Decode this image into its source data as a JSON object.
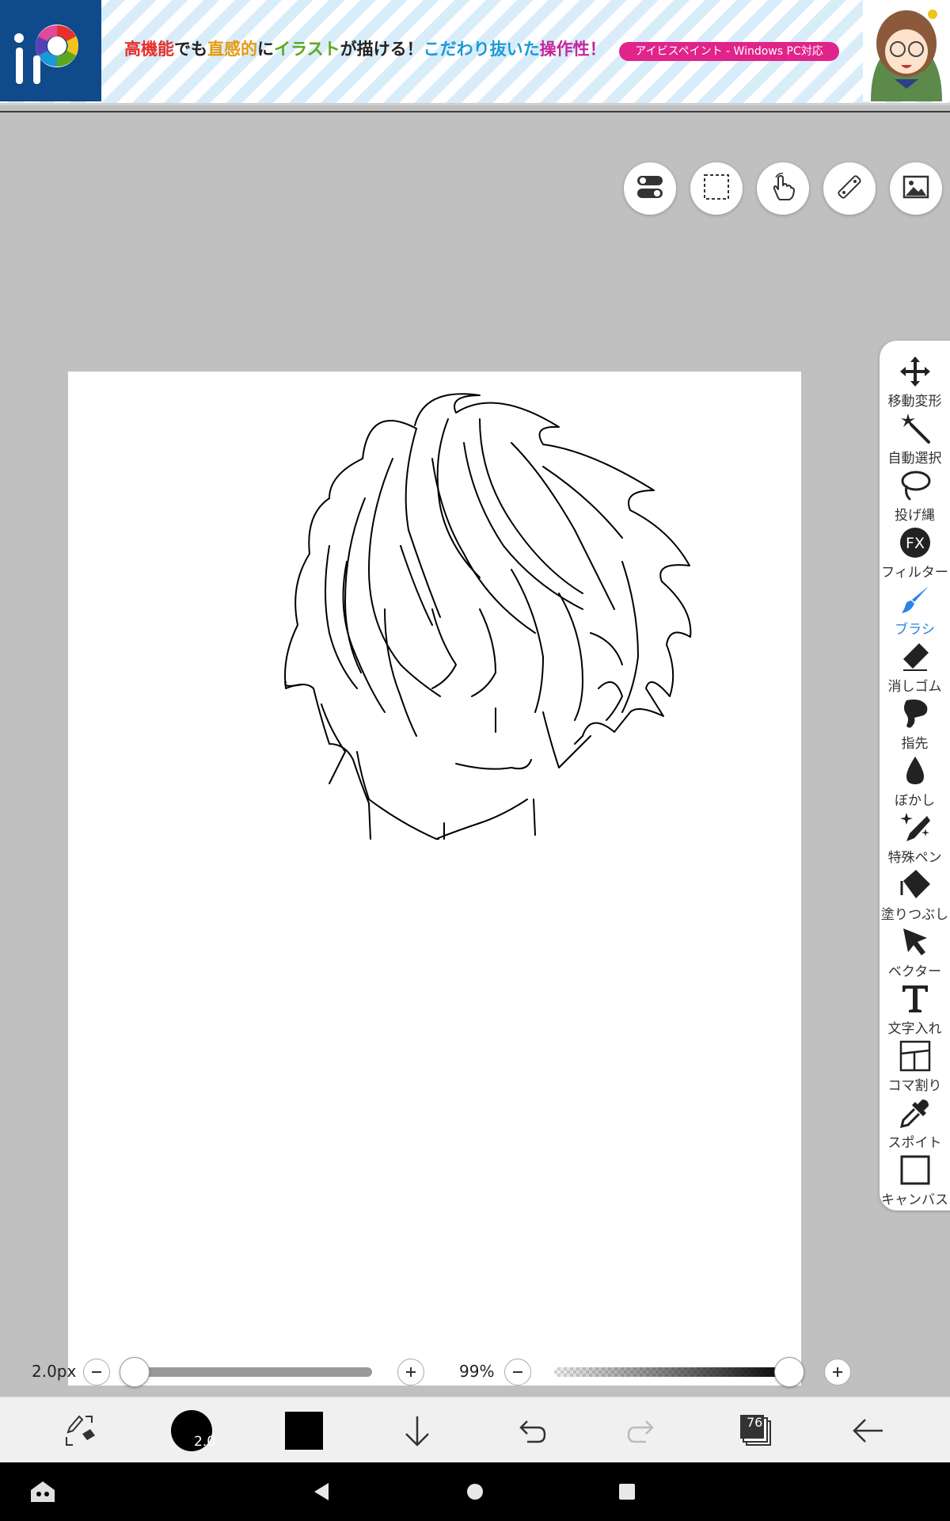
{
  "ad": {
    "segments": [
      {
        "text": "高機能",
        "color": "#e8302a"
      },
      {
        "text": "でも",
        "color": "#222222"
      },
      {
        "text": "直感的",
        "color": "#e39a12"
      },
      {
        "text": "に",
        "color": "#222222"
      },
      {
        "text": "イラスト",
        "color": "#5aa81e"
      },
      {
        "text": "が描ける！",
        "color": "#222222"
      },
      {
        "text": "こだわり抜いた",
        "color": "#1a9ad6"
      },
      {
        "text": "操作性！",
        "color": "#c4269a"
      }
    ],
    "badge": "アイビスペイント - Windows PC対応"
  },
  "top_tools": [
    {
      "name": "settings-toggle-icon"
    },
    {
      "name": "selection-icon"
    },
    {
      "name": "gesture-hand-icon"
    },
    {
      "name": "ruler-icon"
    },
    {
      "name": "gallery-image-icon"
    }
  ],
  "palette": {
    "items": [
      {
        "label": "移動変形",
        "icon": "move-icon"
      },
      {
        "label": "自動選択",
        "icon": "magic-wand-icon"
      },
      {
        "label": "投げ縄",
        "icon": "lasso-icon"
      },
      {
        "label": "フィルター",
        "icon": "fx-filter-icon"
      },
      {
        "label": "ブラシ",
        "icon": "brush-icon",
        "active": true
      },
      {
        "label": "消しゴム",
        "icon": "eraser-icon"
      },
      {
        "label": "指先",
        "icon": "smudge-finger-icon"
      },
      {
        "label": "ぼかし",
        "icon": "blur-drop-icon"
      },
      {
        "label": "特殊ペン",
        "icon": "special-pen-icon"
      },
      {
        "label": "塗りつぶし",
        "icon": "fill-bucket-icon"
      },
      {
        "label": "ベクター",
        "icon": "vector-cursor-icon"
      },
      {
        "label": "文字入れ",
        "icon": "text-icon"
      },
      {
        "label": "コマ割り",
        "icon": "frame-divider-icon"
      },
      {
        "label": "スポイト",
        "icon": "eyedropper-icon"
      },
      {
        "label": "キャンバス",
        "icon": "canvas-icon"
      }
    ],
    "active_color": "#2a84e6"
  },
  "brush": {
    "size_label": "2.0px",
    "size_fraction": 0.0,
    "opacity_label": "99%",
    "opacity_fraction": 0.99,
    "preview_value": "2.0"
  },
  "toolbar": {
    "layer_count": "76",
    "color": "#000000"
  }
}
